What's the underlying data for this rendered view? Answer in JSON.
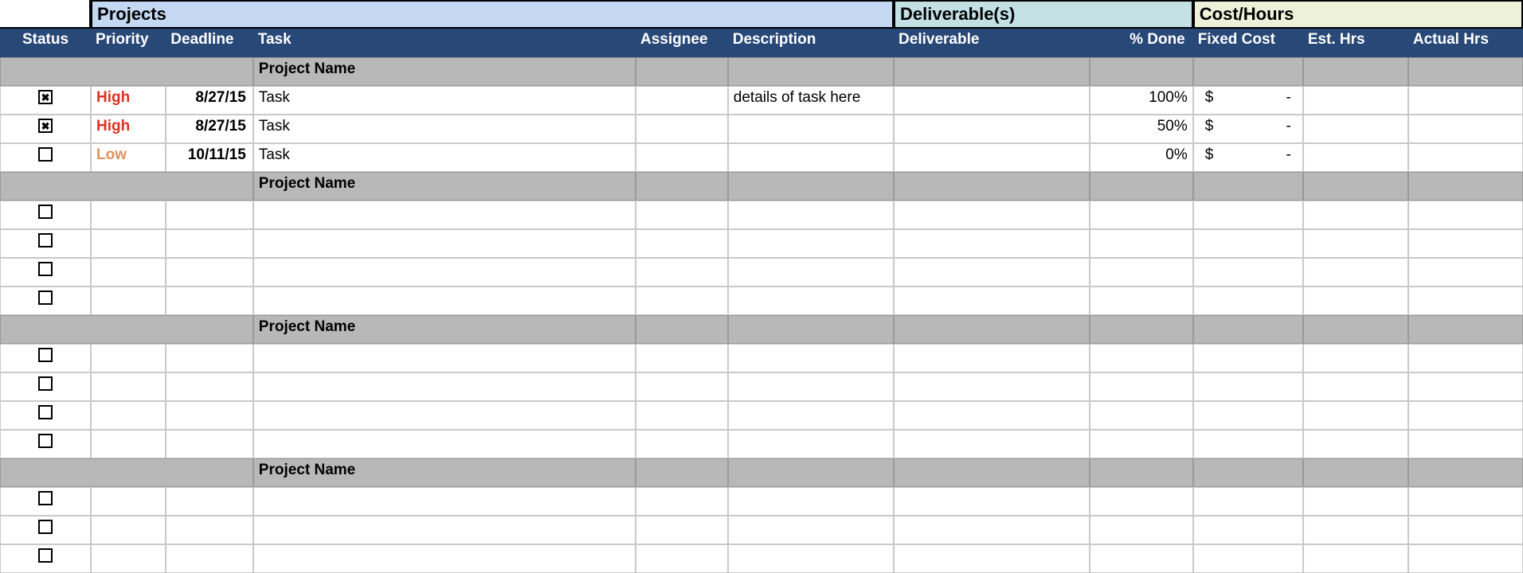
{
  "sections": {
    "projects": "Projects",
    "deliverables": "Deliverable(s)",
    "cost": "Cost/Hours"
  },
  "columns": {
    "status": "Status",
    "priority": "Priority",
    "deadline": "Deadline",
    "task": "Task",
    "assignee": "Assignee",
    "description": "Description",
    "deliverable": "Deliverable",
    "pct_done": "% Done",
    "fixed_cost": "Fixed Cost",
    "est_hrs": "Est. Hrs",
    "actual_hrs": "Actual Hrs"
  },
  "groups": [
    {
      "name": "Project Name",
      "rows": [
        {
          "checked": true,
          "priority": "High",
          "deadline": "8/27/15",
          "task": "Task",
          "assignee": "",
          "description": "details of task here",
          "deliverable": "",
          "pct_done": "100%",
          "fixed_cost_sym": "$",
          "fixed_cost_val": "-",
          "est_hrs": "",
          "actual_hrs": ""
        },
        {
          "checked": true,
          "priority": "High",
          "deadline": "8/27/15",
          "task": "Task",
          "assignee": "",
          "description": "",
          "deliverable": "",
          "pct_done": "50%",
          "fixed_cost_sym": "$",
          "fixed_cost_val": "-",
          "est_hrs": "",
          "actual_hrs": ""
        },
        {
          "checked": false,
          "priority": "Low",
          "deadline": "10/11/15",
          "task": "Task",
          "assignee": "",
          "description": "",
          "deliverable": "",
          "pct_done": "0%",
          "fixed_cost_sym": "$",
          "fixed_cost_val": "-",
          "est_hrs": "",
          "actual_hrs": ""
        }
      ]
    },
    {
      "name": "Project Name",
      "rows": [
        {
          "checked": false,
          "priority": "",
          "deadline": "",
          "task": "",
          "assignee": "",
          "description": "",
          "deliverable": "",
          "pct_done": "",
          "fixed_cost_sym": "",
          "fixed_cost_val": "",
          "est_hrs": "",
          "actual_hrs": ""
        },
        {
          "checked": false,
          "priority": "",
          "deadline": "",
          "task": "",
          "assignee": "",
          "description": "",
          "deliverable": "",
          "pct_done": "",
          "fixed_cost_sym": "",
          "fixed_cost_val": "",
          "est_hrs": "",
          "actual_hrs": ""
        },
        {
          "checked": false,
          "priority": "",
          "deadline": "",
          "task": "",
          "assignee": "",
          "description": "",
          "deliverable": "",
          "pct_done": "",
          "fixed_cost_sym": "",
          "fixed_cost_val": "",
          "est_hrs": "",
          "actual_hrs": ""
        },
        {
          "checked": false,
          "priority": "",
          "deadline": "",
          "task": "",
          "assignee": "",
          "description": "",
          "deliverable": "",
          "pct_done": "",
          "fixed_cost_sym": "",
          "fixed_cost_val": "",
          "est_hrs": "",
          "actual_hrs": ""
        }
      ]
    },
    {
      "name": "Project Name",
      "rows": [
        {
          "checked": false,
          "priority": "",
          "deadline": "",
          "task": "",
          "assignee": "",
          "description": "",
          "deliverable": "",
          "pct_done": "",
          "fixed_cost_sym": "",
          "fixed_cost_val": "",
          "est_hrs": "",
          "actual_hrs": ""
        },
        {
          "checked": false,
          "priority": "",
          "deadline": "",
          "task": "",
          "assignee": "",
          "description": "",
          "deliverable": "",
          "pct_done": "",
          "fixed_cost_sym": "",
          "fixed_cost_val": "",
          "est_hrs": "",
          "actual_hrs": ""
        },
        {
          "checked": false,
          "priority": "",
          "deadline": "",
          "task": "",
          "assignee": "",
          "description": "",
          "deliverable": "",
          "pct_done": "",
          "fixed_cost_sym": "",
          "fixed_cost_val": "",
          "est_hrs": "",
          "actual_hrs": ""
        },
        {
          "checked": false,
          "priority": "",
          "deadline": "",
          "task": "",
          "assignee": "",
          "description": "",
          "deliverable": "",
          "pct_done": "",
          "fixed_cost_sym": "",
          "fixed_cost_val": "",
          "est_hrs": "",
          "actual_hrs": ""
        }
      ]
    },
    {
      "name": "Project Name",
      "rows": [
        {
          "checked": false,
          "priority": "",
          "deadline": "",
          "task": "",
          "assignee": "",
          "description": "",
          "deliverable": "",
          "pct_done": "",
          "fixed_cost_sym": "",
          "fixed_cost_val": "",
          "est_hrs": "",
          "actual_hrs": ""
        },
        {
          "checked": false,
          "priority": "",
          "deadline": "",
          "task": "",
          "assignee": "",
          "description": "",
          "deliverable": "",
          "pct_done": "",
          "fixed_cost_sym": "",
          "fixed_cost_val": "",
          "est_hrs": "",
          "actual_hrs": ""
        },
        {
          "checked": false,
          "priority": "",
          "deadline": "",
          "task": "",
          "assignee": "",
          "description": "",
          "deliverable": "",
          "pct_done": "",
          "fixed_cost_sym": "",
          "fixed_cost_val": "",
          "est_hrs": "",
          "actual_hrs": ""
        }
      ]
    }
  ]
}
